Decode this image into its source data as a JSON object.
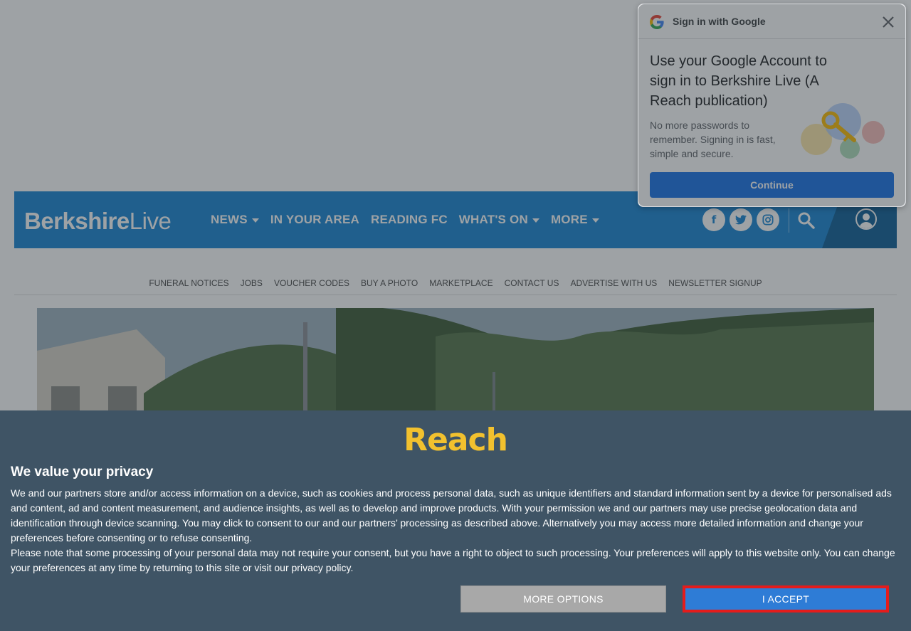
{
  "header": {
    "logo_part1": "Berkshire",
    "logo_part2": "Live",
    "nav": [
      {
        "label": "NEWS",
        "has_dropdown": true
      },
      {
        "label": "IN YOUR AREA",
        "has_dropdown": false
      },
      {
        "label": "READING FC",
        "has_dropdown": false
      },
      {
        "label": "WHAT'S ON",
        "has_dropdown": true
      },
      {
        "label": "MORE",
        "has_dropdown": true
      }
    ],
    "social": {
      "facebook": "f",
      "twitter": "twitter-icon",
      "instagram": "instagram-icon"
    },
    "brand_color": "#1a86d3"
  },
  "subnav": {
    "links": [
      "FUNERAL NOTICES",
      "JOBS",
      "VOUCHER CODES",
      "BUY A PHOTO",
      "MARKETPLACE",
      "CONTACT US",
      "ADVERTISE WITH US",
      "NEWSLETTER SIGNUP"
    ]
  },
  "google_signin": {
    "header": "Sign in with Google",
    "title": "Use your Google Account to sign in to Berkshire Live (A Reach publication)",
    "description": "No more passwords to remember. Signing in is fast, simple and secure.",
    "continue_label": "Continue"
  },
  "consent": {
    "brand": "Reach",
    "title": "We value your privacy",
    "paragraph1": "We and our partners store and/or access information on a device, such as cookies and process personal data, such as unique identifiers and standard information sent by a device for personalised ads and content, ad and content measurement, and audience insights, as well as to develop and improve products. With your permission we and our partners may use precise geolocation data and identification through device scanning. You may click to consent to our and our partners’ processing as described above. Alternatively you may access more detailed information and change your preferences before consenting or to refuse consenting.",
    "paragraph2": "Please note that some processing of your personal data may not require your consent, but you have a right to object to such processing. Your preferences will apply to this website only. You can change your preferences at any time by returning to this site or visit our privacy policy.",
    "more_options_label": "MORE OPTIONS",
    "accept_label": "I ACCEPT"
  }
}
